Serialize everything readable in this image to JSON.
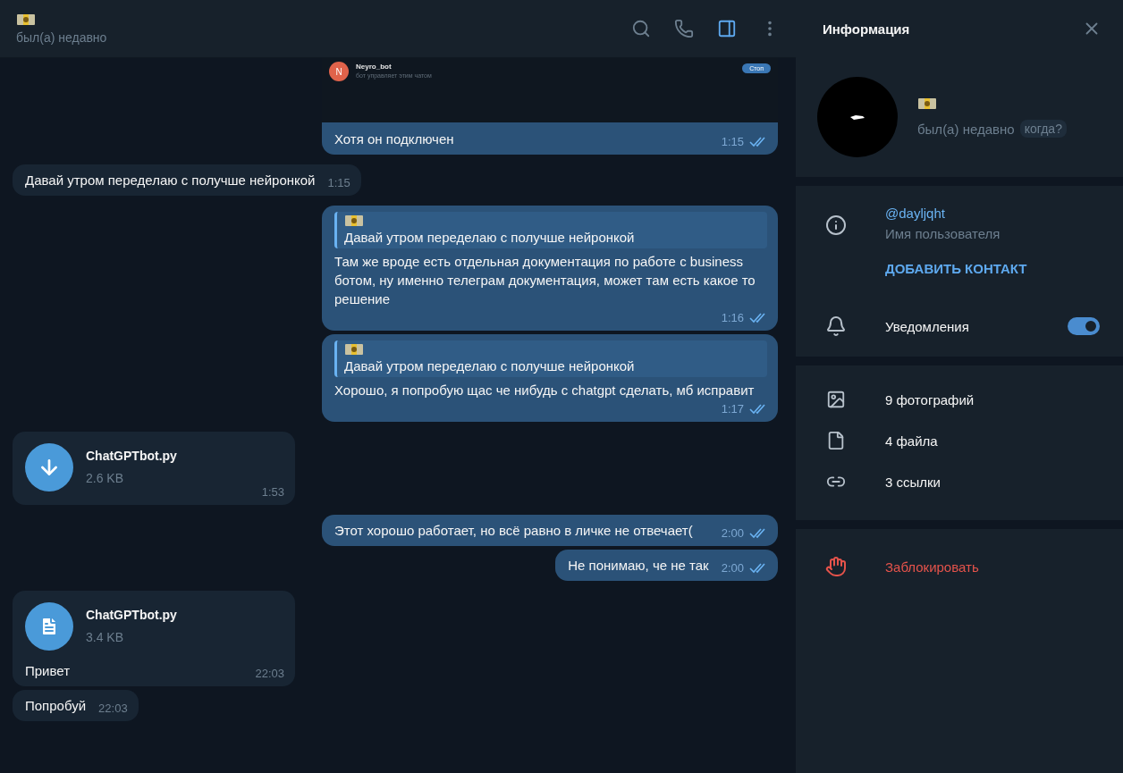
{
  "chat_header": {
    "status": "был(а) недавно",
    "side_panel_open": true
  },
  "messages": [
    {
      "outgoing": true,
      "read": true,
      "embed": {
        "avatar_letter": "N",
        "bot_name": "Neyro_bot",
        "subtitle": "бот управляет этим чатом",
        "button": "Стоп"
      },
      "text": "Хотя он подключен",
      "time": "1:15"
    },
    {
      "outgoing": false,
      "text": "Давай утром переделаю с получше нейронкой",
      "time": "1:15"
    },
    {
      "outgoing": true,
      "read": true,
      "reply": {
        "text": "Давай утром переделаю с получше нейронкой"
      },
      "text": "Там же вроде есть отдельная документация по работе с business ботом, ну именно телеграм документация, может там есть какое то решение",
      "time": "1:16"
    },
    {
      "outgoing": true,
      "read": true,
      "reply": {
        "text": "Давай утром переделаю с получше нейронкой"
      },
      "text": "Хорошо, я попробую щас че нибудь с chatgpt сделать, мб исправит",
      "time": "1:17"
    },
    {
      "outgoing": false,
      "file": {
        "kind": "download",
        "name": "ChatGPTbot.py",
        "size": "2.6 KB"
      },
      "time": "1:53"
    },
    {
      "outgoing": true,
      "read": true,
      "text": "Этот хорошо работает, но всё равно в личке не отвечает(",
      "time": "2:00"
    },
    {
      "outgoing": true,
      "read": true,
      "text": "Не понимаю, че не так",
      "time": "2:00"
    },
    {
      "outgoing": false,
      "file": {
        "kind": "document",
        "name": "ChatGPTbot.py",
        "size": "3.4 KB"
      },
      "text": "Привет",
      "time": "22:03"
    },
    {
      "outgoing": false,
      "text": "Попробуй",
      "time": "22:03"
    }
  ],
  "info_panel": {
    "title": "Информация",
    "status": "был(а) недавно",
    "when_button": "когда?",
    "username": "@dayljqht",
    "username_label": "Имя пользователя",
    "add_contact": "ДОБАВИТЬ КОНТАКТ",
    "notifications": {
      "label": "Уведомления",
      "on": true
    },
    "media": [
      {
        "kind": "photos",
        "label": "9 фотографий"
      },
      {
        "kind": "files",
        "label": "4 файла"
      },
      {
        "kind": "links",
        "label": "3 ссылки"
      }
    ],
    "block": "Заблокировать"
  }
}
